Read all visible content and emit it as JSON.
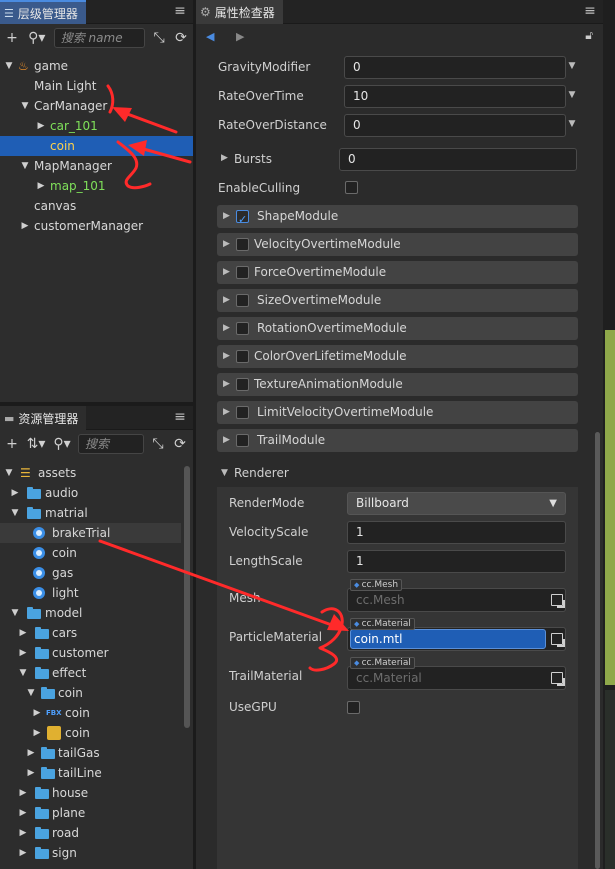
{
  "hierarchy": {
    "title": "层级管理器",
    "search_placeholder": "搜索 name 或 u",
    "nodes": [
      {
        "label": "game"
      },
      {
        "label": "Main Light"
      },
      {
        "label": "CarManager"
      },
      {
        "label": "car_101"
      },
      {
        "label": "coin"
      },
      {
        "label": "MapManager"
      },
      {
        "label": "map_101"
      },
      {
        "label": "canvas"
      },
      {
        "label": "customerManager"
      }
    ]
  },
  "assets": {
    "title": "资源管理器",
    "search_placeholder": "搜索 nam",
    "nodes": [
      {
        "label": "assets"
      },
      {
        "label": "audio"
      },
      {
        "label": "matrial"
      },
      {
        "label": "brakeTrial"
      },
      {
        "label": "coin"
      },
      {
        "label": "gas"
      },
      {
        "label": "light"
      },
      {
        "label": "model"
      },
      {
        "label": "cars"
      },
      {
        "label": "customer"
      },
      {
        "label": "effect"
      },
      {
        "label": "coin"
      },
      {
        "label": "coin"
      },
      {
        "label": "coin"
      },
      {
        "label": "tailGas"
      },
      {
        "label": "tailLine"
      },
      {
        "label": "house"
      },
      {
        "label": "plane"
      },
      {
        "label": "road"
      },
      {
        "label": "sign"
      }
    ],
    "fbx_badge": "FBX"
  },
  "inspector": {
    "title": "属性检查器",
    "props": {
      "gravity_label": "GravityModifier",
      "gravity_value": "0",
      "rate_time_label": "RateOverTime",
      "rate_time_value": "10",
      "rate_dist_label": "RateOverDistance",
      "rate_dist_value": "0",
      "bursts_label": "Bursts",
      "bursts_value": "0",
      "culling_label": "EnableCulling"
    },
    "modules": [
      {
        "label": "ShapeModule",
        "checked": true
      },
      {
        "label": "VelocityOvertimeModule",
        "checked": false
      },
      {
        "label": "ForceOvertimeModule",
        "checked": false
      },
      {
        "label": "SizeOvertimeModule",
        "checked": false
      },
      {
        "label": "RotationOvertimeModule",
        "checked": false
      },
      {
        "label": "ColorOverLifetimeModule",
        "checked": false
      },
      {
        "label": "TextureAnimationModule",
        "checked": false
      },
      {
        "label": "LimitVelocityOvertimeModule",
        "checked": false
      },
      {
        "label": "TrailModule",
        "checked": false
      }
    ],
    "renderer": {
      "label": "Renderer",
      "render_mode_label": "RenderMode",
      "render_mode_value": "Billboard",
      "velocity_scale_label": "VelocityScale",
      "velocity_scale_value": "1",
      "length_scale_label": "LengthScale",
      "length_scale_value": "1",
      "mesh_label": "Mesh",
      "mesh_tag": "cc.Mesh",
      "mesh_value": "cc.Mesh",
      "particle_material_label": "ParticleMaterial",
      "particle_material_tag": "cc.Material",
      "particle_material_value": "coin.mtl",
      "trail_material_label": "TrailMaterial",
      "trail_material_tag": "cc.Material",
      "trail_material_value": "cc.Material",
      "use_gpu_label": "UseGPU"
    }
  },
  "colors": {
    "selection": "#1f5eb5",
    "accent": "#4a8be0",
    "annotation": "#ff2a2a",
    "node_green": "#7fe05a",
    "node_yellow": "#ffcf4a"
  }
}
